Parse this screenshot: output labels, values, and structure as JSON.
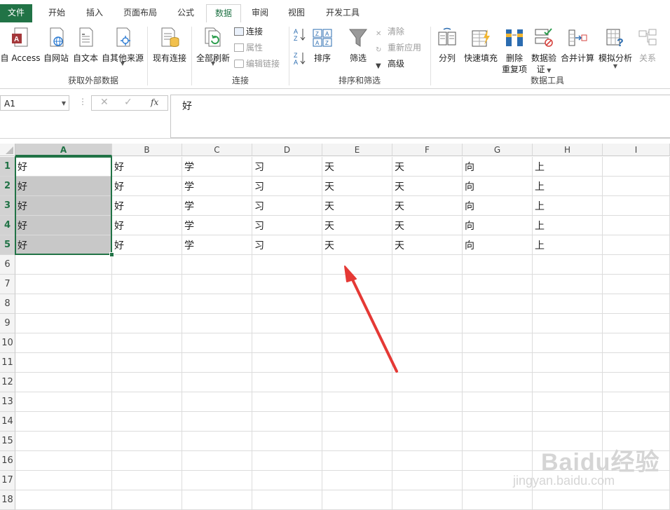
{
  "tabs": [
    "文件",
    "开始",
    "插入",
    "页面布局",
    "公式",
    "数据",
    "审阅",
    "视图",
    "开发工具"
  ],
  "ribbon": {
    "get_external": {
      "access": "自 Access",
      "web": "自网站",
      "text": "自文本",
      "other": "自其他来源",
      "existing": "现有连接",
      "group": "获取外部数据"
    },
    "connections": {
      "refresh_all": "全部刷新",
      "connections": "连接",
      "properties": "属性",
      "edit_links": "编辑链接",
      "group": "连接"
    },
    "sort_filter": {
      "sort": "排序",
      "filter": "筛选",
      "clear": "清除",
      "reapply": "重新应用",
      "advanced": "高级",
      "group": "排序和筛选"
    },
    "data_tools": {
      "text_to_columns": "分列",
      "flash_fill": "快速填充",
      "remove_dup_1": "删除",
      "remove_dup_2": "重复项",
      "validation_1": "数据验",
      "validation_2": "证",
      "consolidate": "合并计算",
      "what_if": "模拟分析",
      "relationships": "关系",
      "group": "数据工具"
    }
  },
  "formula_bar": {
    "name_box": "A1",
    "fx": "fx",
    "content": "好"
  },
  "columns": [
    "A",
    "B",
    "C",
    "D",
    "E",
    "F",
    "G",
    "H",
    "I"
  ],
  "rows": [
    "1",
    "2",
    "3",
    "4",
    "5",
    "6",
    "7",
    "8",
    "9",
    "10",
    "11",
    "12",
    "13",
    "14",
    "15",
    "16",
    "17",
    "18"
  ],
  "cells": [
    [
      "好",
      "好",
      "学",
      "习",
      "天",
      "天",
      "向",
      "上"
    ],
    [
      "好",
      "好",
      "学",
      "习",
      "天",
      "天",
      "向",
      "上"
    ],
    [
      "好",
      "好",
      "学",
      "习",
      "天",
      "天",
      "向",
      "上"
    ],
    [
      "好",
      "好",
      "学",
      "习",
      "天",
      "天",
      "向",
      "上"
    ],
    [
      "好",
      "好",
      "学",
      "习",
      "天",
      "天",
      "向",
      "上"
    ]
  ],
  "watermark": {
    "brand": "Baidu经验",
    "url": "jingyan.baidu.com"
  },
  "colors": {
    "accent": "#217346",
    "selection": "#c8c8c8",
    "arrow": "#e53935"
  }
}
